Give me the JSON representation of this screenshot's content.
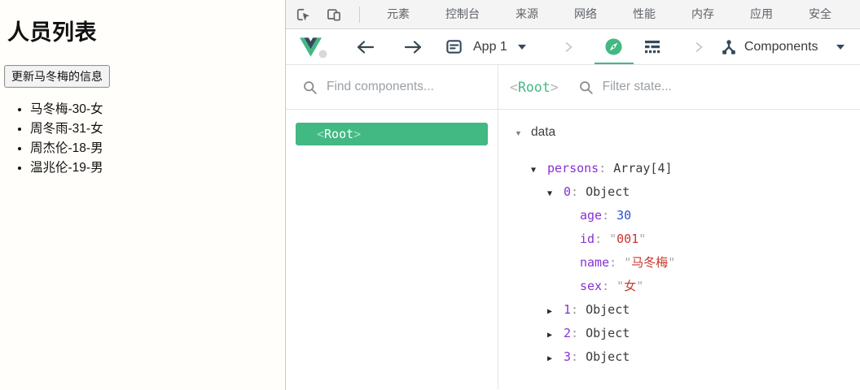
{
  "page": {
    "title": "人员列表",
    "update_button": "更新马冬梅的信息",
    "persons": [
      "马冬梅-30-女",
      "周冬雨-31-女",
      "周杰伦-18-男",
      "温兆伦-19-男"
    ]
  },
  "devtools": {
    "browser_tabs": [
      "元素",
      "控制台",
      "来源",
      "网络",
      "性能",
      "内存",
      "应用",
      "安全"
    ],
    "toolbar": {
      "app_selector_label": "App 1",
      "components_view_label": "Components"
    },
    "component_tree": {
      "search_placeholder": "Find components...",
      "selected_component": {
        "bracket_open": "<",
        "name": "Root",
        "bracket_close": ">"
      }
    },
    "state_panel": {
      "component": {
        "bracket_open": "<",
        "name": "Root",
        "bracket_close": ">"
      },
      "filter_placeholder": "Filter state...",
      "section_label": "data",
      "separator": ":",
      "quote_char": "\"",
      "tree": [
        {
          "level": 1,
          "state": "expanded",
          "key": "persons",
          "value": "Array[4]",
          "vtype": "plain"
        },
        {
          "level": 2,
          "state": "expanded",
          "key": "0",
          "value": "Object",
          "vtype": "plain"
        },
        {
          "level": 3,
          "state": "leaf",
          "key": "age",
          "value": "30",
          "vtype": "number"
        },
        {
          "level": 3,
          "state": "leaf",
          "key": "id",
          "value": "001",
          "vtype": "string"
        },
        {
          "level": 3,
          "state": "leaf",
          "key": "name",
          "value": "马冬梅",
          "vtype": "string"
        },
        {
          "level": 3,
          "state": "leaf",
          "key": "sex",
          "value": "女",
          "vtype": "string"
        },
        {
          "level": 2,
          "state": "collapsed",
          "key": "1",
          "value": "Object",
          "vtype": "plain"
        },
        {
          "level": 2,
          "state": "collapsed",
          "key": "2",
          "value": "Object",
          "vtype": "plain"
        },
        {
          "level": 2,
          "state": "collapsed",
          "key": "3",
          "value": "Object",
          "vtype": "plain"
        }
      ]
    }
  },
  "colors": {
    "vue_green": "#42b883",
    "root_text_green": "#42b983",
    "key_purple": "#8731d4",
    "number_blue": "#2b50d2",
    "string_red": "#c8372d"
  }
}
